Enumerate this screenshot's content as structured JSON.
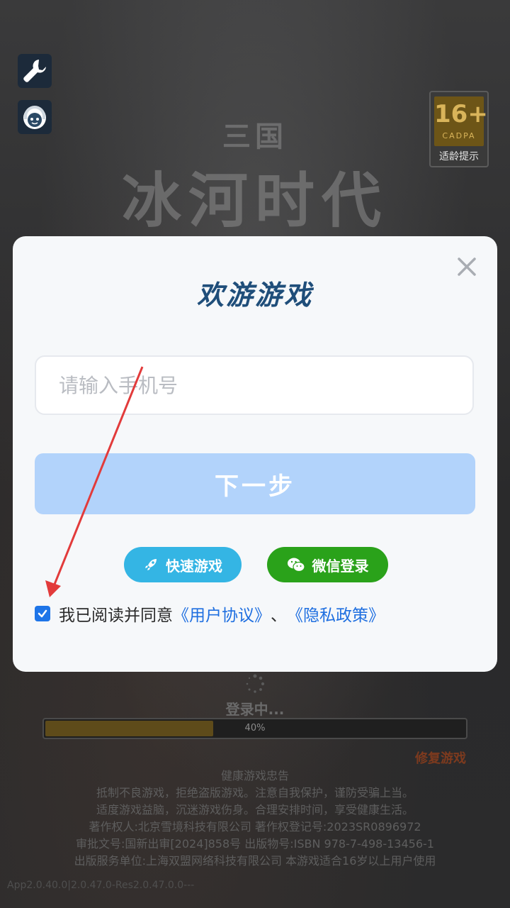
{
  "age_badge": {
    "age": "16+",
    "org": "CADPA",
    "tip": "适龄提示"
  },
  "logo": {
    "small": "三国",
    "big": "冰河时代"
  },
  "dialog": {
    "title": "欢游游戏",
    "phone_placeholder": "请输入手机号",
    "next_label": "下一步",
    "quick_label": "快速游戏",
    "wechat_label": "微信登录",
    "agree_prefix": "我已阅读并同意",
    "user_agreement": "《用户协议》",
    "separator": "、",
    "privacy_policy": "《隐私政策》",
    "agreed": true
  },
  "loading": {
    "text": "登录中...",
    "percent_label": "40%",
    "progress": 0.4
  },
  "repair_label": "修复游戏",
  "notice": {
    "title": "健康游戏忠告",
    "lines": [
      "抵制不良游戏，拒绝盗版游戏。注意自我保护，谨防受骗上当。",
      "适度游戏益脑，沉迷游戏伤身。合理安排时间，享受健康生活。",
      "著作权人:北京雪境科技有限公司 著作权登记号:2023SR0896972",
      "审批文号:国新出审[2024]858号 出版物号:ISBN 978-7-498-13456-1",
      "出版服务单位:上海双盟网络科技有限公司 本游戏适合16岁以上用户使用"
    ]
  },
  "version": "App2.0.40.0|2.0.47.0-Res2.0.47.0.0---",
  "colors": {
    "accent": "#1f6fe0",
    "next_button": "#b2d3fb",
    "quick": "#34b5e4",
    "wechat": "#2aa21a",
    "arrow": "#e23b3b"
  }
}
